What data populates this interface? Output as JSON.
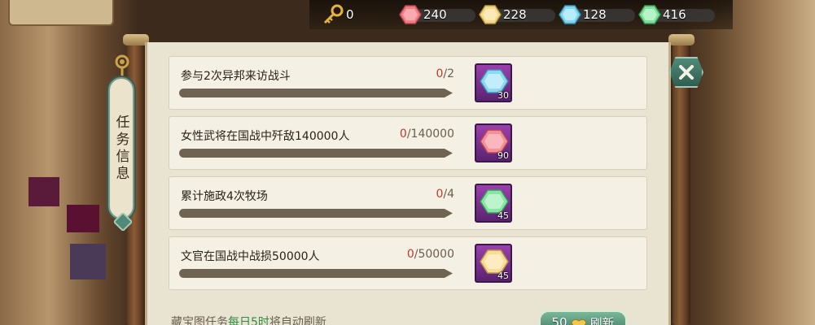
{
  "resources": [
    {
      "icon": "key-icon",
      "value": "0",
      "color": "#e0b040"
    },
    {
      "icon": "red-gem-icon",
      "value": "240",
      "color": "#f07c84"
    },
    {
      "icon": "yellow-gem-icon",
      "value": "228",
      "color": "#f5d98a"
    },
    {
      "icon": "blue-gem-icon",
      "value": "128",
      "color": "#7fd6f0"
    },
    {
      "icon": "green-gem-icon",
      "value": "416",
      "color": "#7fe09a"
    }
  ],
  "panel": {
    "title": "任务信息",
    "tasks": [
      {
        "label": "参与2次异邦来访战斗",
        "current": "0",
        "target": "/2",
        "progress": 0,
        "reward_icon": "blue-gem-icon",
        "reward_color": "#8fd8f2",
        "reward_count": "30"
      },
      {
        "label": "女性武将在国战中歼敌140000人",
        "current": "0",
        "target": "/140000",
        "progress": 0,
        "reward_icon": "red-gem-icon",
        "reward_color": "#f2909a",
        "reward_count": "90"
      },
      {
        "label": "累计施政4次牧场",
        "current": "0",
        "target": "/4",
        "progress": 0,
        "reward_icon": "green-gem-icon",
        "reward_color": "#86e6a2",
        "reward_count": "45"
      },
      {
        "label": "文官在国战中战损50000人",
        "current": "0",
        "target": "/50000",
        "progress": 0,
        "reward_icon": "yellow-gem-icon",
        "reward_color": "#f6dc96",
        "reward_count": "45"
      }
    ],
    "footer": {
      "prefix": "藏宝图任务",
      "highlight": "每日5时",
      "suffix": "将自动刷新"
    },
    "refresh": {
      "cost": "50",
      "label": "刷新"
    }
  },
  "colors": {
    "accent": "#2e8b3e",
    "progress_current": "#c0392b",
    "close_button": "#3f7a62"
  }
}
